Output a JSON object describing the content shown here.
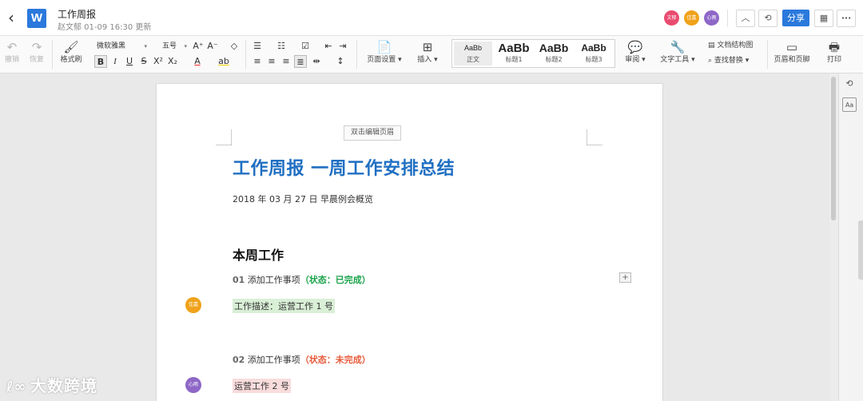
{
  "titlebar": {
    "back_icon": "chevron-left-icon",
    "logo_letter": "W",
    "title": "工作周报",
    "subtitle": "赵文郁 01-09 16:30 更新",
    "collaborators": [
      {
        "name": "文郁",
        "color": "#e94b6f"
      },
      {
        "name": "佳嘉",
        "color": "#f0a21b"
      },
      {
        "name": "心雨",
        "color": "#8e67c7"
      }
    ],
    "share_label": "分享"
  },
  "toolbar": {
    "undo": "撤销",
    "redo": "恢复",
    "format_painter": "格式刷",
    "font_family": "微软雅黑",
    "font_size": "五号",
    "page_setup": "页面设置",
    "insert": "插入",
    "styles": [
      {
        "sample": "AaBb",
        "label": "正文"
      },
      {
        "sample": "AaBb",
        "label": "标题1"
      },
      {
        "sample": "AaBb",
        "label": "标题2"
      },
      {
        "sample": "AaBb",
        "label": "标题3"
      }
    ],
    "review": "审阅",
    "text_tools": "文字工具",
    "doc_map": "文档结构图",
    "find_replace": "查找替换",
    "header_footer": "页眉和页脚",
    "print": "打印"
  },
  "document": {
    "header_hint": "双击编辑页眉",
    "title": "工作周报 一周工作安排总结",
    "dateline": "2018 年 03 月 27 日 早晨例会概览",
    "section": "本周工作",
    "items": [
      {
        "num": "01",
        "text": "添加工作事项",
        "status": "（状态：已完成）",
        "detail": "工作描述：运营工作 1 号",
        "avatar": "佳嘉"
      },
      {
        "num": "02",
        "text": "添加工作事项",
        "status": "（状态：未完成）",
        "detail": "运营工作 2 号",
        "avatar": "心雨"
      }
    ]
  },
  "watermark": "大数跨境",
  "colors": {
    "accent": "#2b79dc",
    "heading": "#1f6fc2",
    "done": "#1aa34a",
    "todo": "#e55b3b"
  }
}
